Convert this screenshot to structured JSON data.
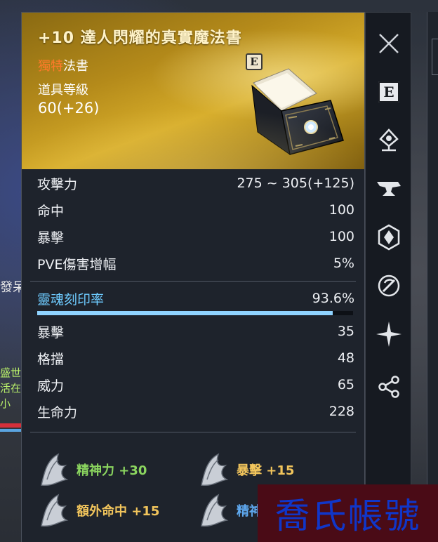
{
  "background": {
    "left_text": "發呆",
    "left_green": [
      "盛世",
      "活在",
      "小"
    ]
  },
  "item": {
    "title": "+10 達人閃耀的真實魔法書",
    "type_highlight": "獨特",
    "type_suffix": "法書",
    "level_label": "道具等級",
    "level_value": "60(+26)",
    "grade_badge": "E"
  },
  "stats": {
    "base": [
      {
        "label": "攻擊力",
        "value": "275 ~ 305(+125)"
      },
      {
        "label": "命中",
        "value": "100"
      },
      {
        "label": "暴擊",
        "value": "100"
      },
      {
        "label": "PVE傷害增幅",
        "value": "5%"
      }
    ],
    "soul": {
      "label": "靈魂刻印率",
      "value": "93.6%",
      "progress": 0.936
    },
    "extra": [
      {
        "label": "暴擊",
        "value": "35"
      },
      {
        "label": "格擋",
        "value": "48"
      },
      {
        "label": "威力",
        "value": "65"
      },
      {
        "label": "生命力",
        "value": "228"
      }
    ]
  },
  "effects": [
    {
      "text": "精神力 +30",
      "color": "green"
    },
    {
      "text": "暴擊 +15",
      "color": "yellow"
    },
    {
      "text": "額外命中 +15",
      "color": "yellow"
    },
    {
      "text": "精神",
      "color": "blue"
    }
  ],
  "sidebar": {
    "icons": [
      "close-icon",
      "grade-e-icon",
      "gem-socket-icon",
      "anvil-icon",
      "crest-icon",
      "soul-icon",
      "star-burst-icon",
      "share-icon"
    ],
    "grade_letter": "E"
  },
  "watermark": "喬氏帳號",
  "colors": {
    "header_gold": "#c79a22",
    "soul_blue": "#6ecbff",
    "effect_green": "#8bd55f",
    "effect_yellow": "#f2c55c",
    "effect_blue": "#5fa9f0",
    "type_orange": "#ff7a2a"
  }
}
